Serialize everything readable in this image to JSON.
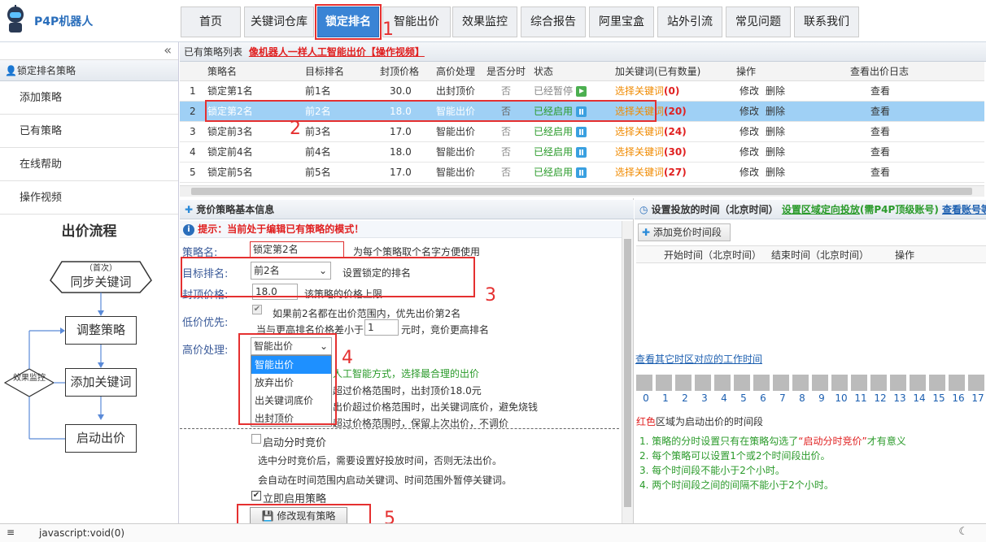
{
  "app": {
    "brand": "P4P机器人"
  },
  "nav": [
    "首页",
    "关键词仓库",
    "锁定排名",
    "智能出价",
    "效果监控",
    "综合报告",
    "阿里宝盒",
    "站外引流",
    "常见问题",
    "联系我们"
  ],
  "annotations": [
    "1",
    "2",
    "3",
    "4",
    "5"
  ],
  "sidebar": {
    "collapse": "«",
    "section": "锁定排名策略",
    "items": [
      "添加策略",
      "已有策略",
      "在线帮助",
      "操作视频"
    ],
    "flow_title": "出价流程",
    "flow": {
      "first_tag": "（首次）",
      "sync": "同步关键词",
      "adjust": "调整策略",
      "monitor": "效果监控",
      "add": "添加关键词",
      "bid": "启动出价"
    }
  },
  "list": {
    "title": "已有策略列表",
    "link": "像机器人一样人工智能出价【操作视频】",
    "headers": [
      "策略名",
      "目标排名",
      "封顶价格",
      "高价处理",
      "是否分时",
      "状态",
      "加关键词(已有数量)",
      "操作",
      "查看出价日志"
    ],
    "rows": [
      {
        "idx": "1",
        "name": "锁定第1名",
        "target": "前1名",
        "price": "30.0",
        "high": "出封顶价",
        "split": "否",
        "status": "已经暂停",
        "kw": "选择关键词",
        "count": "(0)",
        "edit": "修改",
        "del": "删除",
        "log": "查看"
      },
      {
        "idx": "2",
        "name": "锁定第2名",
        "target": "前2名",
        "price": "18.0",
        "high": "智能出价",
        "split": "否",
        "status": "已经启用",
        "kw": "选择关键词",
        "count": "(20)",
        "edit": "修改",
        "del": "删除",
        "log": "查看"
      },
      {
        "idx": "3",
        "name": "锁定前3名",
        "target": "前3名",
        "price": "17.0",
        "high": "智能出价",
        "split": "否",
        "status": "已经启用",
        "kw": "选择关键词",
        "count": "(24)",
        "edit": "修改",
        "del": "删除",
        "log": "查看"
      },
      {
        "idx": "4",
        "name": "锁定前4名",
        "target": "前4名",
        "price": "18.0",
        "high": "智能出价",
        "split": "否",
        "status": "已经启用",
        "kw": "选择关键词",
        "count": "(30)",
        "edit": "修改",
        "del": "删除",
        "log": "查看"
      },
      {
        "idx": "5",
        "name": "锁定前5名",
        "target": "前5名",
        "price": "17.0",
        "high": "智能出价",
        "split": "否",
        "status": "已经启用",
        "kw": "选择关键词",
        "count": "(27)",
        "edit": "修改",
        "del": "删除",
        "log": "查看"
      }
    ]
  },
  "form": {
    "title": "竞价策略基本信息",
    "tip": "提示：当前处于编辑已有策略的模式！",
    "name_label": "策略名:",
    "name_value": "锁定第2名",
    "name_hint": "为每个策略取个名字方便使用",
    "target_label": "目标排名:",
    "target_value": "前2名",
    "target_hint": "设置锁定的排名",
    "price_label": "封顶价格:",
    "price_value": "18.0",
    "price_hint": "该策略的价格上限",
    "low_label": "低价优先:",
    "low_line1": "如果前2名都在出价范围内，优先出价第2名",
    "low_line2a": "当与更高排名价格差小于",
    "low_value": "1",
    "low_line2b": "元时，竞价更高排名",
    "high_label": "高价处理:",
    "high_value": "智能出价",
    "high_options": [
      "智能出价",
      "放弃出价",
      "出关键词底价",
      "出封顶价"
    ],
    "high_desc": [
      "人工智能方式，选择最合理的出价",
      "超过价格范围时，出封顶价18.0元",
      "出价超过价格范围时，出关键词底价，避免烧钱",
      "超过价格范围时，保留上次出价，不调价"
    ],
    "split_label": "启动分时竞价",
    "split_desc1": "选中分时竞价后，需要设置好投放时间，否则无法出价。",
    "split_desc2": "会自动在时间范围内启动关键词、时间范围外暂停关键词。",
    "enable_label": "立即启用策略",
    "submit": "修改现有策略"
  },
  "time": {
    "title": "设置投放的时间（北京时间）",
    "link1": "设置区域定向投放",
    "link1_suffix": "(需P4P顶级账号)",
    "link2": "查看账号等级",
    "add_btn": "添加竞价时间段",
    "headers": [
      "开始时间（北京时间）",
      "结束时间（北京时间）",
      "操作"
    ],
    "tz_link": "查看其它时区对应的工作时间",
    "hours": [
      "0",
      "1",
      "2",
      "3",
      "4",
      "5",
      "6",
      "7",
      "8",
      "9",
      "10",
      "11",
      "12",
      "13",
      "14",
      "15",
      "16",
      "17"
    ],
    "legend_red": "红色",
    "legend_rest": "区域为启动出价的时间段",
    "notes": [
      "1. 策略的分时设置只有在策略勾选了",
      "“启动分时竞价”",
      "才有意义",
      "2. 每个策略可以设置1个或2个时间段出价。",
      "3. 每个时间段不能小于2个小时。",
      "4. 两个时间段之间的间隔不能小于2个小时。"
    ]
  },
  "status": "javascript:void(0)"
}
